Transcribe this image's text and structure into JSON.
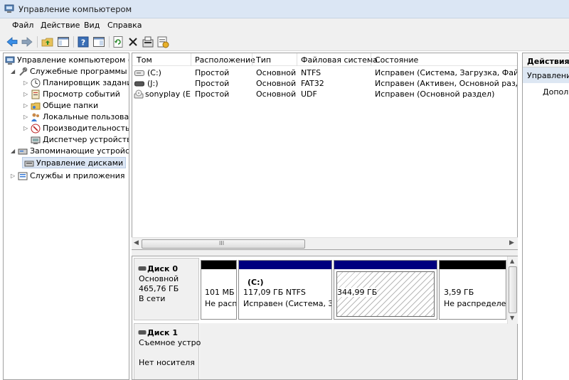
{
  "window": {
    "title": "Управление компьютером"
  },
  "menu": [
    "Файл",
    "Действие",
    "Вид",
    "Справка"
  ],
  "toolbar": {
    "icons": [
      "back-arrow-icon",
      "forward-arrow-icon",
      "up-folder-icon",
      "show-hide-tree-icon",
      "help-icon",
      "properties-view-icon",
      "refresh-icon",
      "delete-icon",
      "properties-icon",
      "export-icon"
    ]
  },
  "tree": {
    "root": "Управление компьютером (л",
    "service_tools": "Служебные программы",
    "task_scheduler": "Планировщик заданий",
    "event_viewer": "Просмотр событий",
    "shared_folders": "Общие папки",
    "local_users": "Локальные пользовате",
    "performance": "Производительность",
    "device_manager": "Диспетчер устройств",
    "storage": "Запоминающие устройст",
    "disk_management": "Управление дисками",
    "services_apps": "Службы и приложения"
  },
  "volumes": {
    "columns": [
      "Том",
      "Расположение",
      "Тип",
      "Файловая система",
      "Состояние"
    ],
    "rows": [
      {
        "volume": "(C:)",
        "layout": "Простой",
        "type": "Основной",
        "fs": "NTFS",
        "status": "Исправен (Система, Загрузка, Файл под"
      },
      {
        "volume": "(J:)",
        "layout": "Простой",
        "type": "Основной",
        "fs": "FAT32",
        "status": "Исправен (Активен, Основной раздел)"
      },
      {
        "volume": "sonyplay (E:)",
        "layout": "Простой",
        "type": "Основной",
        "fs": "UDF",
        "status": "Исправен (Основной раздел)"
      }
    ],
    "scroll_grip": "III"
  },
  "disks": [
    {
      "name": "Диск 0",
      "kind": "Основной",
      "size": "465,76 ГБ",
      "state": "В сети",
      "partitions": [
        {
          "label": "",
          "size": "101 МБ",
          "status": "Не расп",
          "band_color": "#000000"
        },
        {
          "label": "(C:)",
          "size": "117,09 ГБ NTFS",
          "status": "Исправен (Система, Заг",
          "band_color": "#00007f"
        },
        {
          "label": "",
          "size": "344,99 ГБ",
          "status": "",
          "band_color": "#00007f"
        },
        {
          "label": "",
          "size": "3,59 ГБ",
          "status": "Не распределен",
          "band_color": "#000000"
        }
      ]
    },
    {
      "name": "Диск 1",
      "kind": "Съемное устро",
      "state": "Нет носителя"
    }
  ],
  "actions": {
    "header": "Действия",
    "section": "Управление",
    "item": "Дополн"
  }
}
